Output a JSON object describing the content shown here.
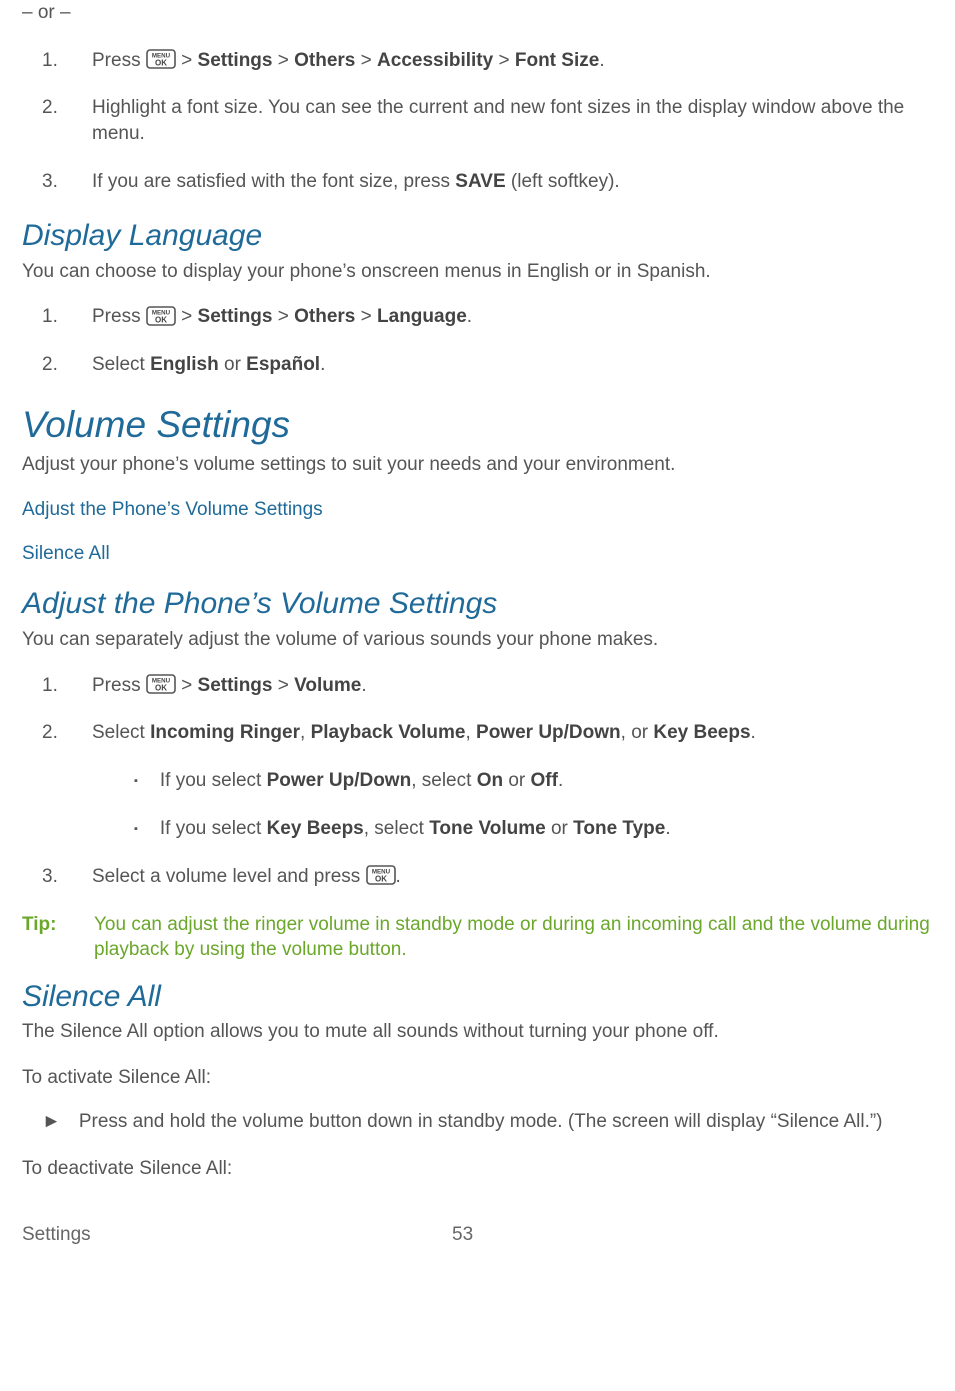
{
  "txt": {
    "or": "– or –",
    "s1n1": "1.",
    "s1l1a": "Press ",
    "s1l1b": " > ",
    "b_settings": "Settings",
    "b_others": "Others",
    "b_access": "Accessibility",
    "b_font": "Font Size",
    "s1l1c": ".",
    "s1n2": "2.",
    "s1l2": "Highlight a font size. You can see the current and new font sizes in the display window above the menu.",
    "s1n3": "3.",
    "s1l3a": "If you are satisfied with the font size, press ",
    "b_save": "SAVE",
    "s1l3b": " (left softkey).",
    "h_display": "Display Language",
    "display_intro": "You can choose to display your phone’s onscreen menus in English or in Spanish.",
    "s2n1": "1.",
    "s2l1a": "Press ",
    "s2l1b": " > ",
    "b_lang": "Language",
    "s2l1c": ".",
    "s2n2": "2.",
    "s2l2a": "Select ",
    "b_eng": "English",
    "s2l2b": " or ",
    "b_esp": "Español",
    "s2l2c": ".",
    "h_volume": "Volume Settings",
    "volume_intro": "Adjust your phone’s volume settings to suit your needs and your environment.",
    "link_adjust": "Adjust the Phone’s Volume Settings",
    "link_silence": "Silence All",
    "h_adjust": "Adjust the Phone’s Volume Settings",
    "adjust_intro": "You can separately adjust the volume of various sounds your phone makes.",
    "s3n1": "1.",
    "s3l1a": "Press ",
    "s3l1b": " > ",
    "b_volume": "Volume",
    "s3l1c": ".",
    "s3n2": "2.",
    "s3l2a": "Select ",
    "b_ir": "Incoming Ringer",
    "s3l2b": ", ",
    "b_pv": "Playback Volume",
    "b_pud": "Power Up/Down",
    "s3l2c": ", or ",
    "b_kb": "Key Beeps",
    "s3l2d": ".",
    "sub1a": "If you select ",
    "sub1b": ", select ",
    "b_on": "On",
    "sub1c": " or ",
    "b_off": "Off",
    "sub1d": ".",
    "sub2a": "If you select ",
    "sub2b": ", select ",
    "b_tv": "Tone Volume",
    "sub2c": " or ",
    "b_tt": "Tone Type",
    "sub2d": ".",
    "s3n3": "3.",
    "s3l3a": "Select a volume level and press ",
    "s3l3b": ".",
    "tip_label": "Tip:",
    "tip_text": "You can adjust the ringer volume in standby mode or during an incoming call and the volume during playback by using the volume button.",
    "h_silence": "Silence All",
    "silence_intro": "The Silence All option allows you to mute all sounds without turning your phone off.",
    "activate": "To activate Silence All:",
    "arr1": "Press and hold the volume button down in standby mode. (The screen will display “Silence All.”)",
    "deactivate": "To deactivate Silence All:",
    "footer_left": "Settings",
    "footer_page": "53",
    "arrow": "►",
    "square": "▪"
  }
}
